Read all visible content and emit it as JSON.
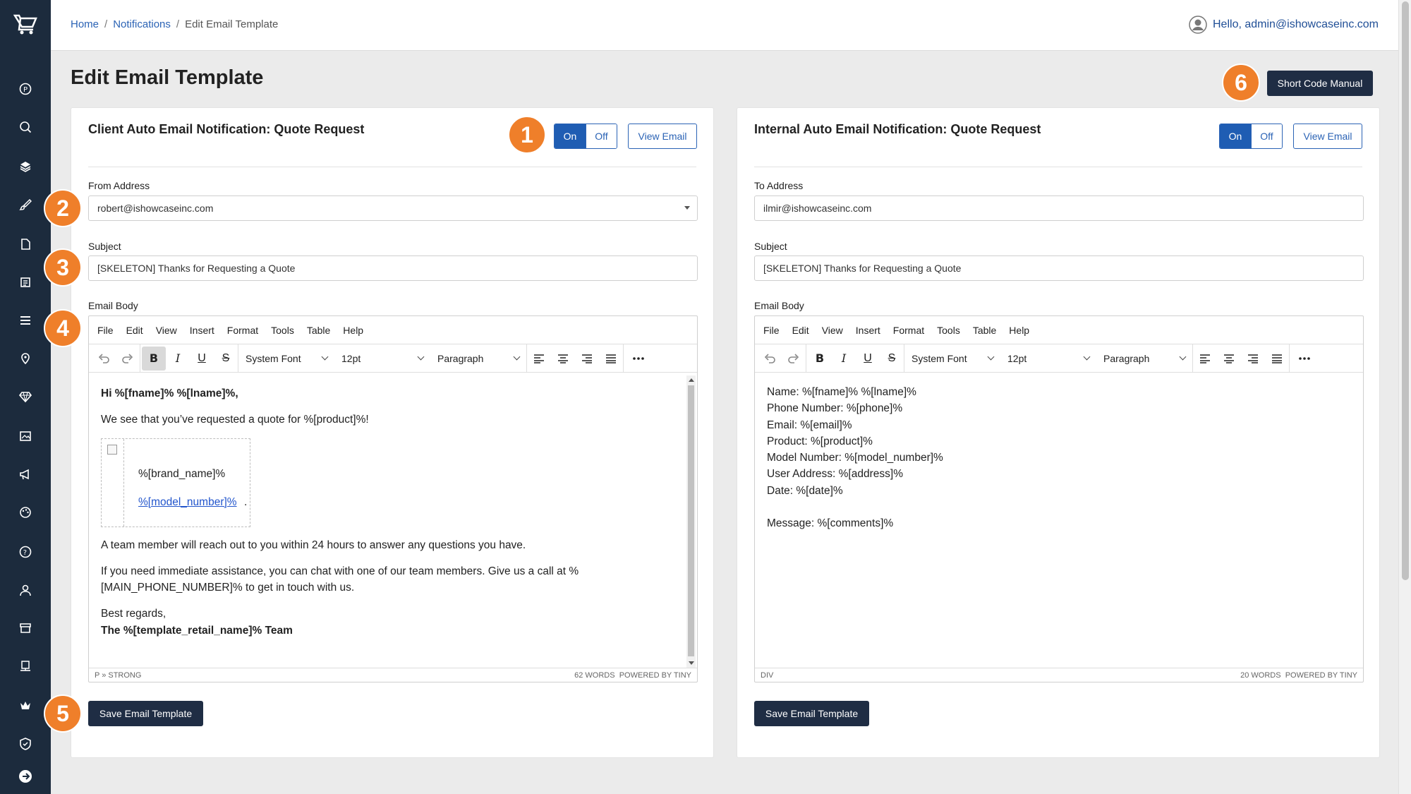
{
  "colors": {
    "sidebar_bg": "#1c2b3d",
    "primary": "#1f5db3",
    "dark_button": "#1f2d44",
    "marker": "#ef7f2a"
  },
  "sidebar": {
    "icons": [
      "logo-cart-icon",
      "parking-icon",
      "search-icon",
      "layers-icon",
      "brush-icon",
      "file-icon",
      "list-icon",
      "menu-icon",
      "location-icon",
      "diamond-icon",
      "image-icon",
      "megaphone-icon",
      "palette-icon",
      "help-icon",
      "user-icon",
      "store-icon",
      "server-icon",
      "crown-icon",
      "shield-icon",
      "logout-icon"
    ]
  },
  "breadcrumb": {
    "home": "Home",
    "notifications": "Notifications",
    "current": "Edit Email Template",
    "sep": "/"
  },
  "user": {
    "greeting": "Hello, admin@ishowcaseinc.com"
  },
  "page": {
    "title": "Edit Email Template",
    "manual_label": "Short Code Manual"
  },
  "markers": [
    "1",
    "2",
    "3",
    "4",
    "5",
    "6"
  ],
  "editor_common": {
    "menu": [
      "File",
      "Edit",
      "View",
      "Insert",
      "Format",
      "Tools",
      "Table",
      "Help"
    ],
    "font": "System Font",
    "size": "12pt",
    "block": "Paragraph",
    "powered": "POWERED BY TINY"
  },
  "left": {
    "title": "Client Auto Email Notification: Quote Request",
    "on_label": "On",
    "off_label": "Off",
    "view_label": "View Email",
    "from_label": "From Address",
    "from_value": "robert@ishowcaseinc.com",
    "subject_label": "Subject",
    "subject_value": "[SKELETON] Thanks for Requesting a Quote",
    "body_label": "Email Body",
    "body": {
      "greeting": "Hi %[fname]% %[lname]%,",
      "line1": "We see that you’ve requested a quote for %[product]%!",
      "brand": "%[brand_name]%",
      "model": "%[model_number]%",
      "model_suffix": ".",
      "line2": "A team member will reach out to you within 24 hours to answer any questions you have.",
      "line3": "If you need immediate assistance, you can chat with one of our team members. Give us a call at %[MAIN_PHONE_NUMBER]% to get in touch with us.",
      "closing": "Best regards,",
      "signature": "The %[template_retail_name]% Team"
    },
    "path": "P » STRONG",
    "words": "62 WORDS",
    "save_label": "Save Email Template"
  },
  "right": {
    "title": "Internal Auto Email Notification: Quote Request",
    "on_label": "On",
    "off_label": "Off",
    "view_label": "View Email",
    "to_label": "To Address",
    "to_value": "ilmir@ishowcaseinc.com",
    "subject_label": "Subject",
    "subject_value": "[SKELETON] Thanks for Requesting a Quote",
    "body_label": "Email Body",
    "body_lines": [
      "Name: %[fname]% %[lname]%",
      "Phone Number: %[phone]%",
      "Email: %[email]%",
      "Product: %[product]%",
      "Model Number: %[model_number]%",
      "User Address: %[address]%",
      "Date: %[date]%",
      "",
      "Message: %[comments]%"
    ],
    "path": "DIV",
    "words": "20 WORDS",
    "save_label": "Save Email Template"
  }
}
